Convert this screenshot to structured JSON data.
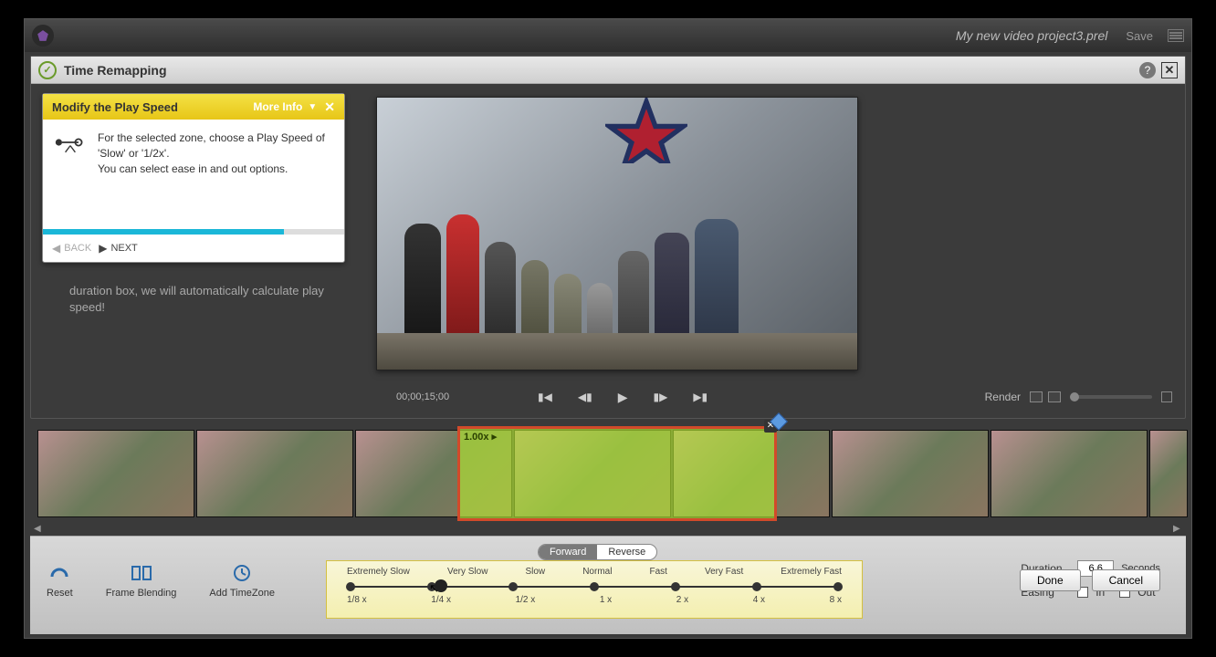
{
  "titlebar": {
    "project_name": "My new video project3.prel",
    "save_label": "Save"
  },
  "panel": {
    "title": "Time Remapping"
  },
  "tip": {
    "title": "Modify the Play Speed",
    "more_info": "More Info",
    "body": "For the selected zone, choose a Play Speed of 'Slow' or '1/2x'.\nYou can select ease in and out options.",
    "back": "BACK",
    "next": "NEXT",
    "progress_pct": 80
  },
  "hidden_text": "duration box, we will automatically calculate play speed!",
  "timecode": "00;00;15;00",
  "render_label": "Render",
  "selection": {
    "speed_label": "1.00x ▸"
  },
  "direction": {
    "forward": "Forward",
    "reverse": "Reverse",
    "active": "forward"
  },
  "control_buttons": {
    "reset": "Reset",
    "frame_blending": "Frame Blending",
    "add_timezone": "Add TimeZone"
  },
  "speed_slider": {
    "labels": [
      "Extremely Slow",
      "Very Slow",
      "Slow",
      "Normal",
      "Fast",
      "Very Fast",
      "Extremely Fast"
    ],
    "values": [
      "1/8 x",
      "1/4 x",
      "1/2 x",
      "1 x",
      "2 x",
      "4 x",
      "8 x"
    ]
  },
  "duration": {
    "label": "Duration",
    "value": "6.6",
    "unit": "Seconds"
  },
  "easing": {
    "label": "Easing",
    "in": "In",
    "out": "Out"
  },
  "buttons": {
    "done": "Done",
    "cancel": "Cancel"
  }
}
